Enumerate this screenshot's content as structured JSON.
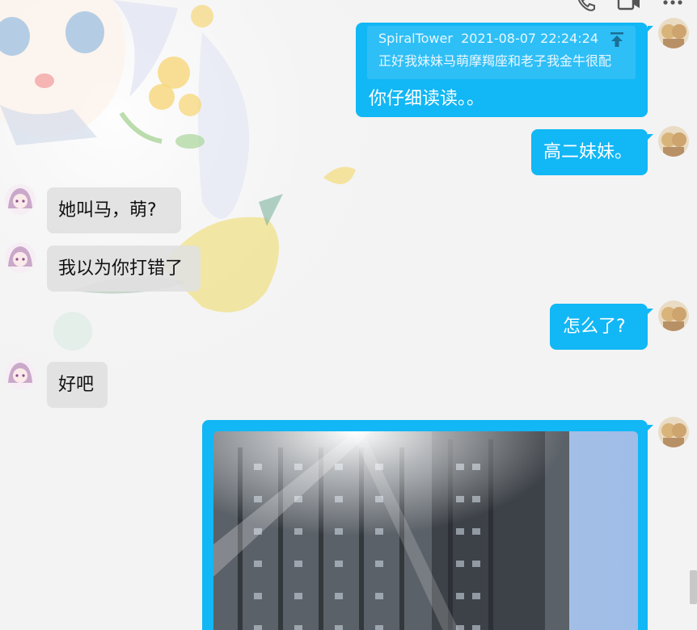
{
  "toolbar": {
    "icons": [
      "phone-icon",
      "video-call-icon",
      "more-icon"
    ]
  },
  "messages": [
    {
      "side": "right",
      "quote": {
        "author": "SpiralTower",
        "time": "2021-08-07 22:24:24",
        "text": "正好我妹妹马萌摩羯座和老子我金牛很配"
      },
      "text": "你仔细读读。。"
    },
    {
      "side": "right",
      "text": "高二妹妹。"
    },
    {
      "side": "left",
      "text": "她叫马，萌?"
    },
    {
      "side": "left",
      "text": "我以为你打错了"
    },
    {
      "side": "right",
      "text": "怎么了?"
    },
    {
      "side": "left",
      "text": "好吧"
    },
    {
      "side": "right",
      "type": "image",
      "description": ""
    }
  ],
  "colors": {
    "self_bubble": "#12b7f5",
    "other_bubble": "#e0e0e0",
    "background": "#f3f3f3"
  }
}
